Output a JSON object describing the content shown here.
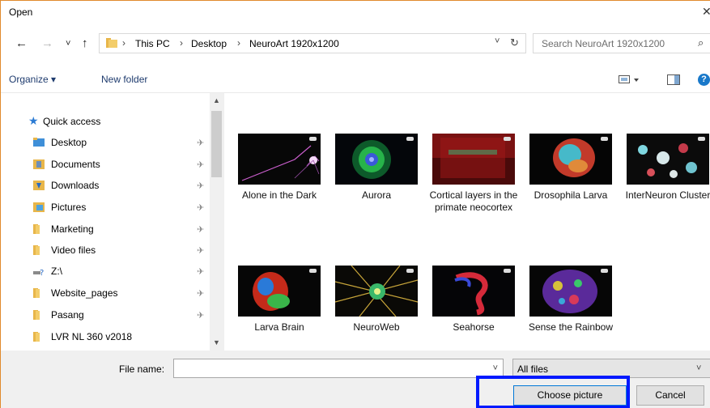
{
  "window": {
    "title": "Open",
    "close": "✕"
  },
  "address": {
    "back": "←",
    "forward": "→",
    "recent": "˅",
    "up": "↑",
    "crumbs": [
      "This PC",
      "Desktop",
      "NeuroArt 1920x1200"
    ],
    "separator": "›",
    "dropdown": "˅",
    "refresh": "↻",
    "search_placeholder": "Search NeuroArt 1920x1200",
    "search_icon": "⌕"
  },
  "toolbar": {
    "organize": "Organize ▾",
    "new_folder": "New folder",
    "help": "?"
  },
  "nav": {
    "quick_access": "Quick access",
    "items": [
      {
        "label": "Desktop",
        "icon": "desktop-folder-icon",
        "pinned": true
      },
      {
        "label": "Documents",
        "icon": "documents-folder-icon",
        "pinned": true
      },
      {
        "label": "Downloads",
        "icon": "downloads-folder-icon",
        "pinned": true
      },
      {
        "label": "Pictures",
        "icon": "pictures-folder-icon",
        "pinned": true
      },
      {
        "label": "Marketing",
        "icon": "folder-icon",
        "pinned": true
      },
      {
        "label": "Video files",
        "icon": "folder-icon",
        "pinned": true
      },
      {
        "label": "Z:\\",
        "icon": "network-drive-icon",
        "pinned": true
      },
      {
        "label": "Website_pages",
        "icon": "folder-icon",
        "pinned": true
      },
      {
        "label": "Pasang",
        "icon": "folder-icon",
        "pinned": true
      },
      {
        "label": "LVR NL 360 v2018",
        "icon": "folder-icon",
        "pinned": false
      }
    ],
    "pin_glyph": "📌"
  },
  "files": [
    {
      "name": "Alone in the Dark"
    },
    {
      "name": "Aurora"
    },
    {
      "name": "Cortical layers in the primate neocortex"
    },
    {
      "name": "Drosophila Larva"
    },
    {
      "name": "InterNeuron Cluster"
    },
    {
      "name": "Larva Brain"
    },
    {
      "name": "NeuroWeb"
    },
    {
      "name": "Seahorse"
    },
    {
      "name": "Sense the Rainbow"
    }
  ],
  "bottom": {
    "file_name_label": "File name:",
    "file_name_value": "",
    "filter": "All files",
    "choose": "Choose picture",
    "cancel": "Cancel"
  },
  "colors": {
    "window_border": "#e08a2c",
    "highlight": "#0019ff",
    "folder": "#e8b64a",
    "accent": "#1979ca"
  }
}
